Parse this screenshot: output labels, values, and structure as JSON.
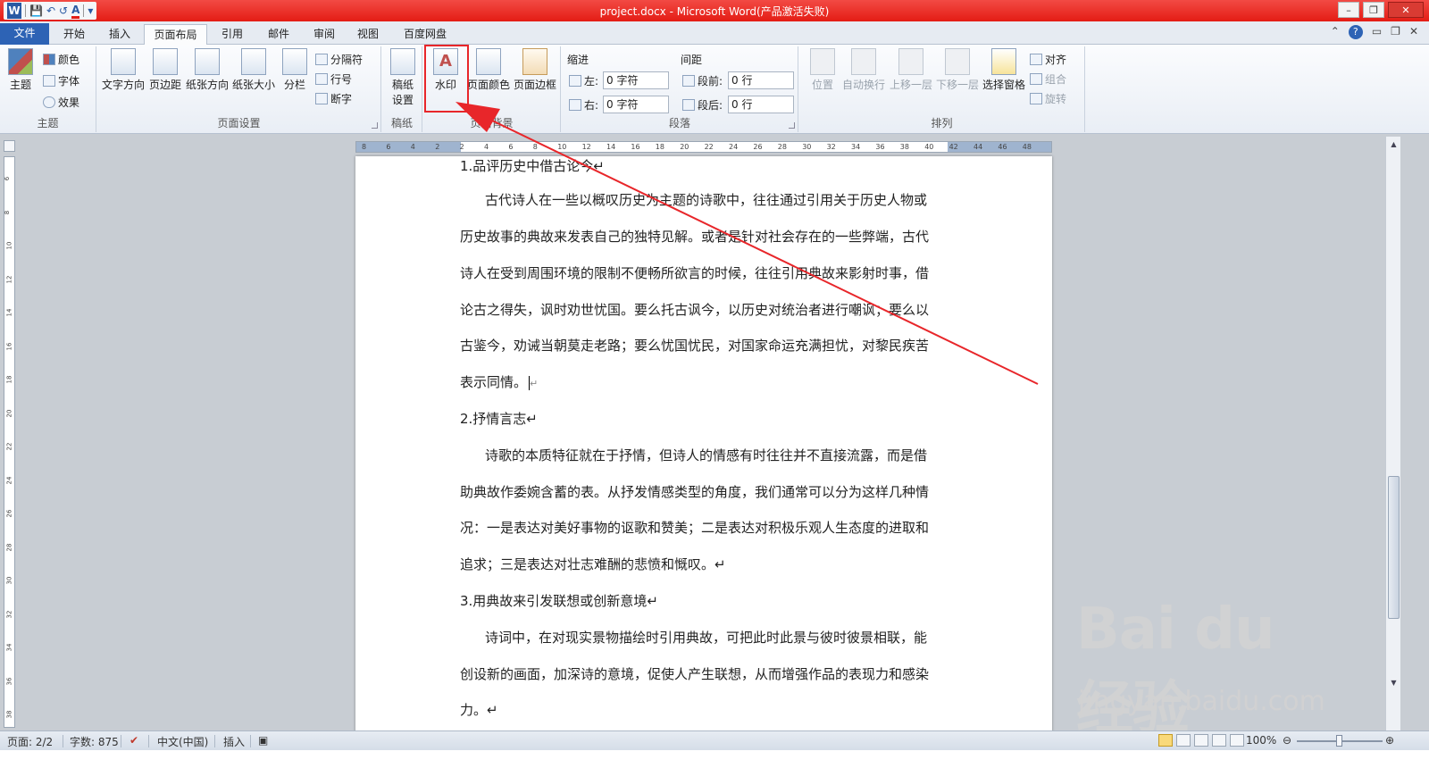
{
  "window": {
    "title": "project.docx  -  Microsoft Word(产品激活失败)",
    "qat": {
      "word_icon": "W",
      "save_icon": "💾",
      "undo_icon": "↶",
      "redo_icon": "↺",
      "font_color_icon": "A",
      "customize_icon": "▾"
    },
    "controls": {
      "minimize": "–",
      "restore": "❐",
      "close": "✕"
    }
  },
  "tabs": {
    "file": "文件",
    "home": "开始",
    "insert": "插入",
    "page_layout": "页面布局",
    "references": "引用",
    "mailings": "邮件",
    "review": "审阅",
    "view": "视图",
    "baidu": "百度网盘",
    "right_icons": {
      "collapse": "⌃",
      "help": "?",
      "min": "▭",
      "restore": "❐",
      "close": "✕"
    }
  },
  "ribbon": {
    "themes": {
      "label": "主题",
      "theme_btn": "主题",
      "colors": "颜色",
      "fonts": "字体",
      "effects": "效果"
    },
    "page_setup": {
      "label": "页面设置",
      "text_direction": "文字方向",
      "margins": "页边距",
      "orientation": "纸张方向",
      "size": "纸张大小",
      "columns": "分栏",
      "breaks": "分隔符",
      "line_numbers": "行号",
      "hyphenation": "断字"
    },
    "manuscript": {
      "label": "稿纸",
      "setup_line1": "稿纸",
      "setup_line2": "设置"
    },
    "page_background": {
      "label": "页面背景",
      "watermark": "水印",
      "page_color": "页面颜色",
      "page_borders": "页面边框"
    },
    "paragraph": {
      "label": "段落",
      "indent_title": "缩进",
      "spacing_title": "间距",
      "left_label": "左:",
      "left_value": "0 字符",
      "right_label": "右:",
      "right_value": "0 字符",
      "before_label": "段前:",
      "before_value": "0 行",
      "after_label": "段后:",
      "after_value": "0 行"
    },
    "arrange": {
      "label": "排列",
      "position": "位置",
      "wrap_text": "自动换行",
      "bring_forward": "上移一层",
      "send_backward": "下移一层",
      "selection_pane": "选择窗格",
      "align": "对齐",
      "group": "组合",
      "rotate": "旋转"
    }
  },
  "ruler": {
    "h_ticks": [
      "8",
      "6",
      "4",
      "2",
      "2",
      "4",
      "6",
      "8",
      "10",
      "12",
      "14",
      "16",
      "18",
      "20",
      "22",
      "24",
      "26",
      "28",
      "30",
      "32",
      "34",
      "36",
      "38",
      "40",
      "42",
      "44",
      "46",
      "48"
    ],
    "v_ticks": [
      "6",
      "8",
      "10",
      "12",
      "14",
      "16",
      "18",
      "20",
      "22",
      "24",
      "26",
      "28",
      "30",
      "32",
      "34",
      "36",
      "38"
    ]
  },
  "document": {
    "paragraphs": [
      "1.品评历史中借古论今↵",
      "古代诗人在一些以概叹历史为主题的诗歌中，往往通过引用关于历史人物或",
      "历史故事的典故来发表自己的独特见解。或者是针对社会存在的一些弊端，古代",
      "诗人在受到周围环境的限制不便畅所欲言的时候，往往引用典故来影射时事，借",
      "论古之得失，讽时劝世忧国。要么托古讽今，以历史对统治者进行嘲讽；要么以",
      "古鉴今，劝诫当朝莫走老路；要么忧国忧民，对国家命运充满担忧，对黎民疾苦",
      "表示同情。",
      "2.抒情言志↵",
      "诗歌的本质特征就在于抒情，但诗人的情感有时往往并不直接流露，而是借",
      "助典故作委婉含蓄的表。从抒发情感类型的角度，我们通常可以分为这样几种情",
      "况：一是表达对美好事物的讴歌和赞美；二是表达对积极乐观人生态度的进取和",
      "追求；三是表达对壮志难酬的悲愤和慨叹。↵",
      "3.用典故来引发联想或创新意境↵",
      "诗词中，在对现实景物描绘时引用典故，可把此时此景与彼时彼景相联，能",
      "创设新的画面，加深诗的意境，促使人产生联想，从而增强作品的表现力和感染",
      "力。↵"
    ],
    "return_mark": "↵"
  },
  "status": {
    "page": "页面: 2/2",
    "words": "字数: 875",
    "language": "中文(中国)",
    "mode": "插入",
    "zoom": "100%"
  },
  "watermark": {
    "logo": "Bai du 经验",
    "url": "jingyan.baidu.com"
  },
  "colors": {
    "title_red": "#e41c14",
    "file_tab_blue": "#2d63b5",
    "annotation_red": "#e8262a"
  }
}
